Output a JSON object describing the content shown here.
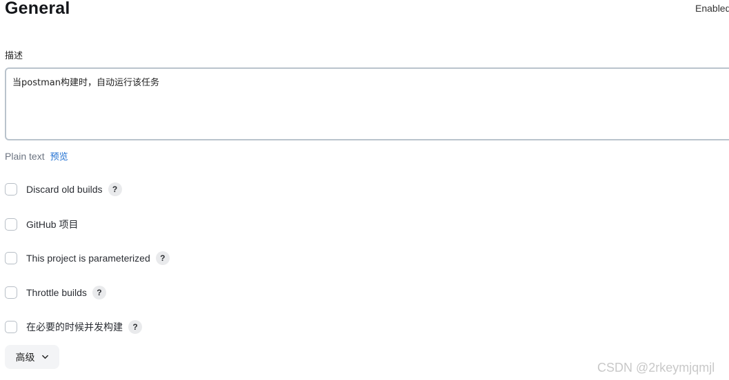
{
  "header": {
    "title": "General",
    "enabled_label": "Enabled"
  },
  "description": {
    "label": "描述",
    "value": "当postman构建时，自动运行该任务"
  },
  "format": {
    "plain_text": "Plain text",
    "preview": "预览"
  },
  "options": [
    {
      "label": "Discard old builds",
      "checked": false,
      "has_help": true,
      "help": "?"
    },
    {
      "label": "GitHub 项目",
      "checked": false,
      "has_help": false
    },
    {
      "label": "This project is parameterized",
      "checked": false,
      "has_help": true,
      "help": "?"
    },
    {
      "label": "Throttle builds",
      "checked": false,
      "has_help": true,
      "help": "?"
    },
    {
      "label": "在必要的时候并发构建",
      "checked": false,
      "has_help": true,
      "help": "?"
    }
  ],
  "advanced": {
    "label": "高级",
    "icon": "chevron-down-icon"
  },
  "watermark": "CSDN @2rkeymjqmjl"
}
